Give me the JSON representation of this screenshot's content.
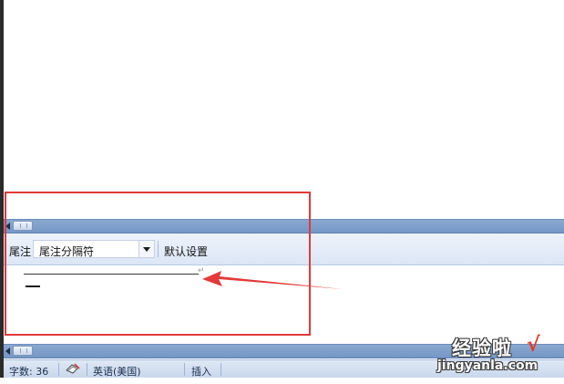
{
  "endnote_pane": {
    "label": "尾注",
    "separator_value": "尾注分隔符",
    "reset_label": "默认设置"
  },
  "endnote_content": {
    "paragraph_mark": "↵"
  },
  "status_bar": {
    "word_count": "字数: 36",
    "language": "英语(美国)",
    "input_mode": "插入"
  },
  "watermark": {
    "title": "经验啦",
    "check": "√",
    "url": "jingyanla.com"
  },
  "colors": {
    "highlight": "#e03a3a",
    "scrollbar": "#7c9bc9",
    "status_bar": "#d2def0"
  },
  "icons": {
    "proofing": "proofing-book-icon",
    "scroll_left": "scroll-left-arrow-icon",
    "dropdown": "chevron-down-icon"
  }
}
